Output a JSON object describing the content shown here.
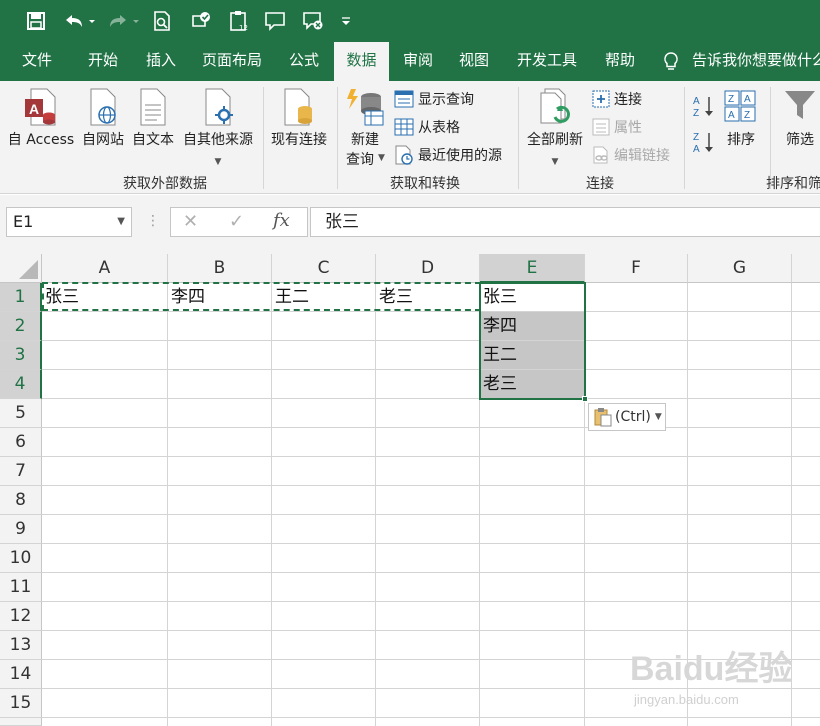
{
  "quick_access": {
    "icons": [
      "save-icon",
      "undo-icon",
      "redo-icon",
      "print-preview-icon",
      "share-icon",
      "clipboard-12-icon",
      "comment-icon",
      "comment-delete-icon",
      "customize-qat-icon"
    ]
  },
  "tabs": [
    "文件",
    "开始",
    "插入",
    "页面布局",
    "公式",
    "数据",
    "审阅",
    "视图",
    "开发工具",
    "帮助"
  ],
  "active_tab": "数据",
  "tell_me": "告诉我你想要做什么",
  "ribbon": {
    "get_external": {
      "label": "获取外部数据",
      "from_access": "自 Access",
      "from_web": "自网站",
      "from_text": "自文本",
      "from_other": "自其他来源",
      "existing": "现有连接"
    },
    "get_transform": {
      "label": "获取和转换",
      "new_query_l1": "新建",
      "new_query_l2": "查询",
      "show_queries": "显示查询",
      "from_table": "从表格",
      "recent_sources": "最近使用的源"
    },
    "connections": {
      "label": "连接",
      "refresh_all": "全部刷新",
      "connections": "连接",
      "properties": "属性",
      "edit_links": "编辑链接"
    },
    "sort_filter": {
      "label": "排序和筛",
      "sort": "排序",
      "filter": "筛选"
    }
  },
  "formula_bar": {
    "name_box": "E1",
    "formula": "张三"
  },
  "grid": {
    "columns": [
      "A",
      "B",
      "C",
      "D",
      "E",
      "F",
      "G"
    ],
    "rows": [
      "1",
      "2",
      "3",
      "4",
      "5",
      "6",
      "7",
      "8",
      "9",
      "10",
      "11",
      "12",
      "13",
      "14",
      "15"
    ],
    "row1": [
      "张三",
      "李四",
      "王二",
      "老三"
    ],
    "col_e": [
      "张三",
      "李四",
      "王二",
      "老三"
    ]
  },
  "paste_options": "(Ctrl)",
  "watermark": {
    "logo": "Baidu经验",
    "url": "jingyan.baidu.com"
  },
  "colors": {
    "excel_green": "#217346",
    "selection_gray": "#c6c6c6"
  }
}
